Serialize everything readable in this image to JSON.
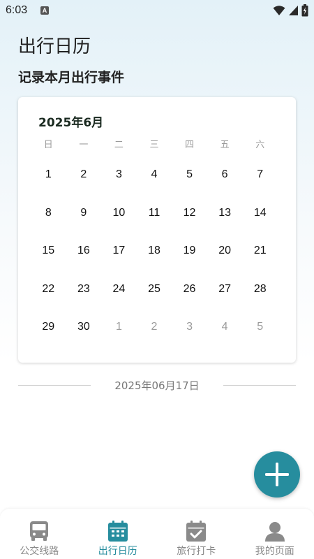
{
  "status_bar": {
    "time": "6:03",
    "notification_icon": "a-icon",
    "icons": [
      "wifi-icon",
      "signal-icon",
      "battery-icon"
    ]
  },
  "header": {
    "title": "出行日历",
    "subtitle": "记录本月出行事件"
  },
  "calendar": {
    "month_label": "2025年6月",
    "weekdays": [
      "日",
      "一",
      "二",
      "三",
      "四",
      "五",
      "六"
    ],
    "days": [
      {
        "label": "1",
        "current": true
      },
      {
        "label": "2",
        "current": true
      },
      {
        "label": "3",
        "current": true
      },
      {
        "label": "4",
        "current": true
      },
      {
        "label": "5",
        "current": true
      },
      {
        "label": "6",
        "current": true
      },
      {
        "label": "7",
        "current": true
      },
      {
        "label": "8",
        "current": true
      },
      {
        "label": "9",
        "current": true
      },
      {
        "label": "10",
        "current": true
      },
      {
        "label": "11",
        "current": true
      },
      {
        "label": "12",
        "current": true
      },
      {
        "label": "13",
        "current": true
      },
      {
        "label": "14",
        "current": true
      },
      {
        "label": "15",
        "current": true
      },
      {
        "label": "16",
        "current": true
      },
      {
        "label": "17",
        "current": true
      },
      {
        "label": "18",
        "current": true
      },
      {
        "label": "19",
        "current": true
      },
      {
        "label": "20",
        "current": true
      },
      {
        "label": "21",
        "current": true
      },
      {
        "label": "22",
        "current": true
      },
      {
        "label": "23",
        "current": true
      },
      {
        "label": "24",
        "current": true
      },
      {
        "label": "25",
        "current": true
      },
      {
        "label": "26",
        "current": true
      },
      {
        "label": "27",
        "current": true
      },
      {
        "label": "28",
        "current": true
      },
      {
        "label": "29",
        "current": true
      },
      {
        "label": "30",
        "current": true
      },
      {
        "label": "1",
        "current": false
      },
      {
        "label": "2",
        "current": false
      },
      {
        "label": "3",
        "current": false
      },
      {
        "label": "4",
        "current": false
      },
      {
        "label": "5",
        "current": false
      }
    ]
  },
  "selected_date": "2025年06月17日",
  "fab": {
    "icon": "plus-icon",
    "color": "#268d9e"
  },
  "bottom_nav": {
    "accent_color": "#268d9e",
    "inactive_color": "#8a8a8a",
    "items": [
      {
        "label": "公交线路",
        "icon": "bus-icon",
        "active": false
      },
      {
        "label": "出行日历",
        "icon": "calendar-icon",
        "active": true
      },
      {
        "label": "旅行打卡",
        "icon": "calendar-check-icon",
        "active": false
      },
      {
        "label": "我的页面",
        "icon": "person-icon",
        "active": false
      }
    ]
  }
}
